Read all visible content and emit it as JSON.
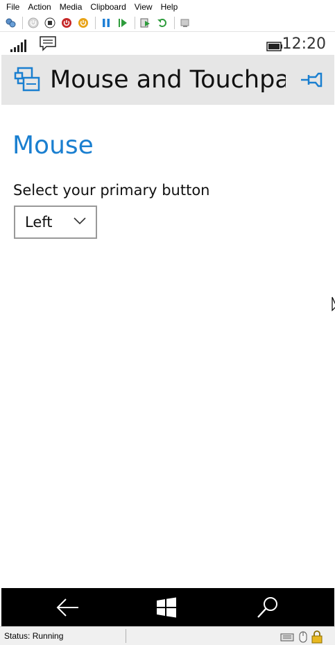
{
  "menubar": {
    "items": [
      "File",
      "Action",
      "Media",
      "Clipboard",
      "View",
      "Help"
    ]
  },
  "toolbar": {
    "icons": [
      "settings-icon",
      "power-off-icon",
      "stop-icon",
      "shutdown-icon",
      "power-icon",
      "pause-icon",
      "resume-icon",
      "reset-icon",
      "revert-icon",
      "checkpoint-icon"
    ]
  },
  "phone_status": {
    "time": "12:20"
  },
  "header": {
    "title": "Mouse and Touchpac"
  },
  "content": {
    "section_title": "Mouse",
    "field_label": "Select your primary button",
    "dropdown_value": "Left"
  },
  "window_status": {
    "text": "Status: Running"
  },
  "colors": {
    "accent": "#1a7fd0",
    "header_bg": "#e6e6e6",
    "nav_bg": "#000000"
  }
}
